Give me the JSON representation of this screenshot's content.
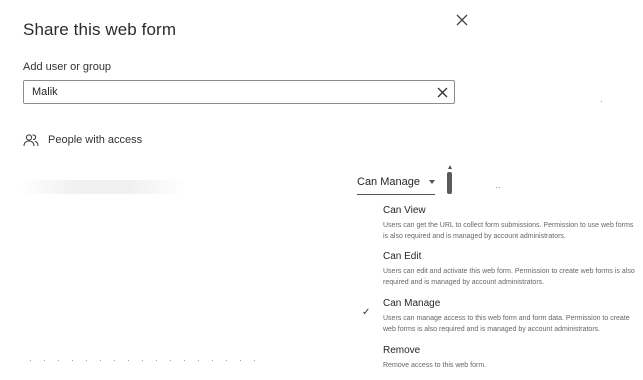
{
  "dialog": {
    "title": "Share this web form",
    "close_icon": "close-icon"
  },
  "search": {
    "label": "Add user or group",
    "value": "Malik",
    "clear_icon": "close-icon"
  },
  "access": {
    "icon": "people-icon",
    "label": "People with access"
  },
  "permission": {
    "selected": "Can Manage",
    "options": [
      {
        "title": "Can View",
        "description": "Users can get the URL to collect form submissions. Permission to use web forms is also required and is managed by account administrators.",
        "checked": false
      },
      {
        "title": "Can Edit",
        "description": "Users can edit and activate this web form. Permission to create web forms is also required and is managed by account administrators.",
        "checked": false
      },
      {
        "title": "Can Manage",
        "description": "Users can manage access to this web form and form data. Permission to create web forms is also required and is managed by account administrators.",
        "checked": true
      },
      {
        "title": "Remove",
        "description": "Remove access to this web form.",
        "checked": false
      }
    ],
    "check_glyph": "✓"
  }
}
